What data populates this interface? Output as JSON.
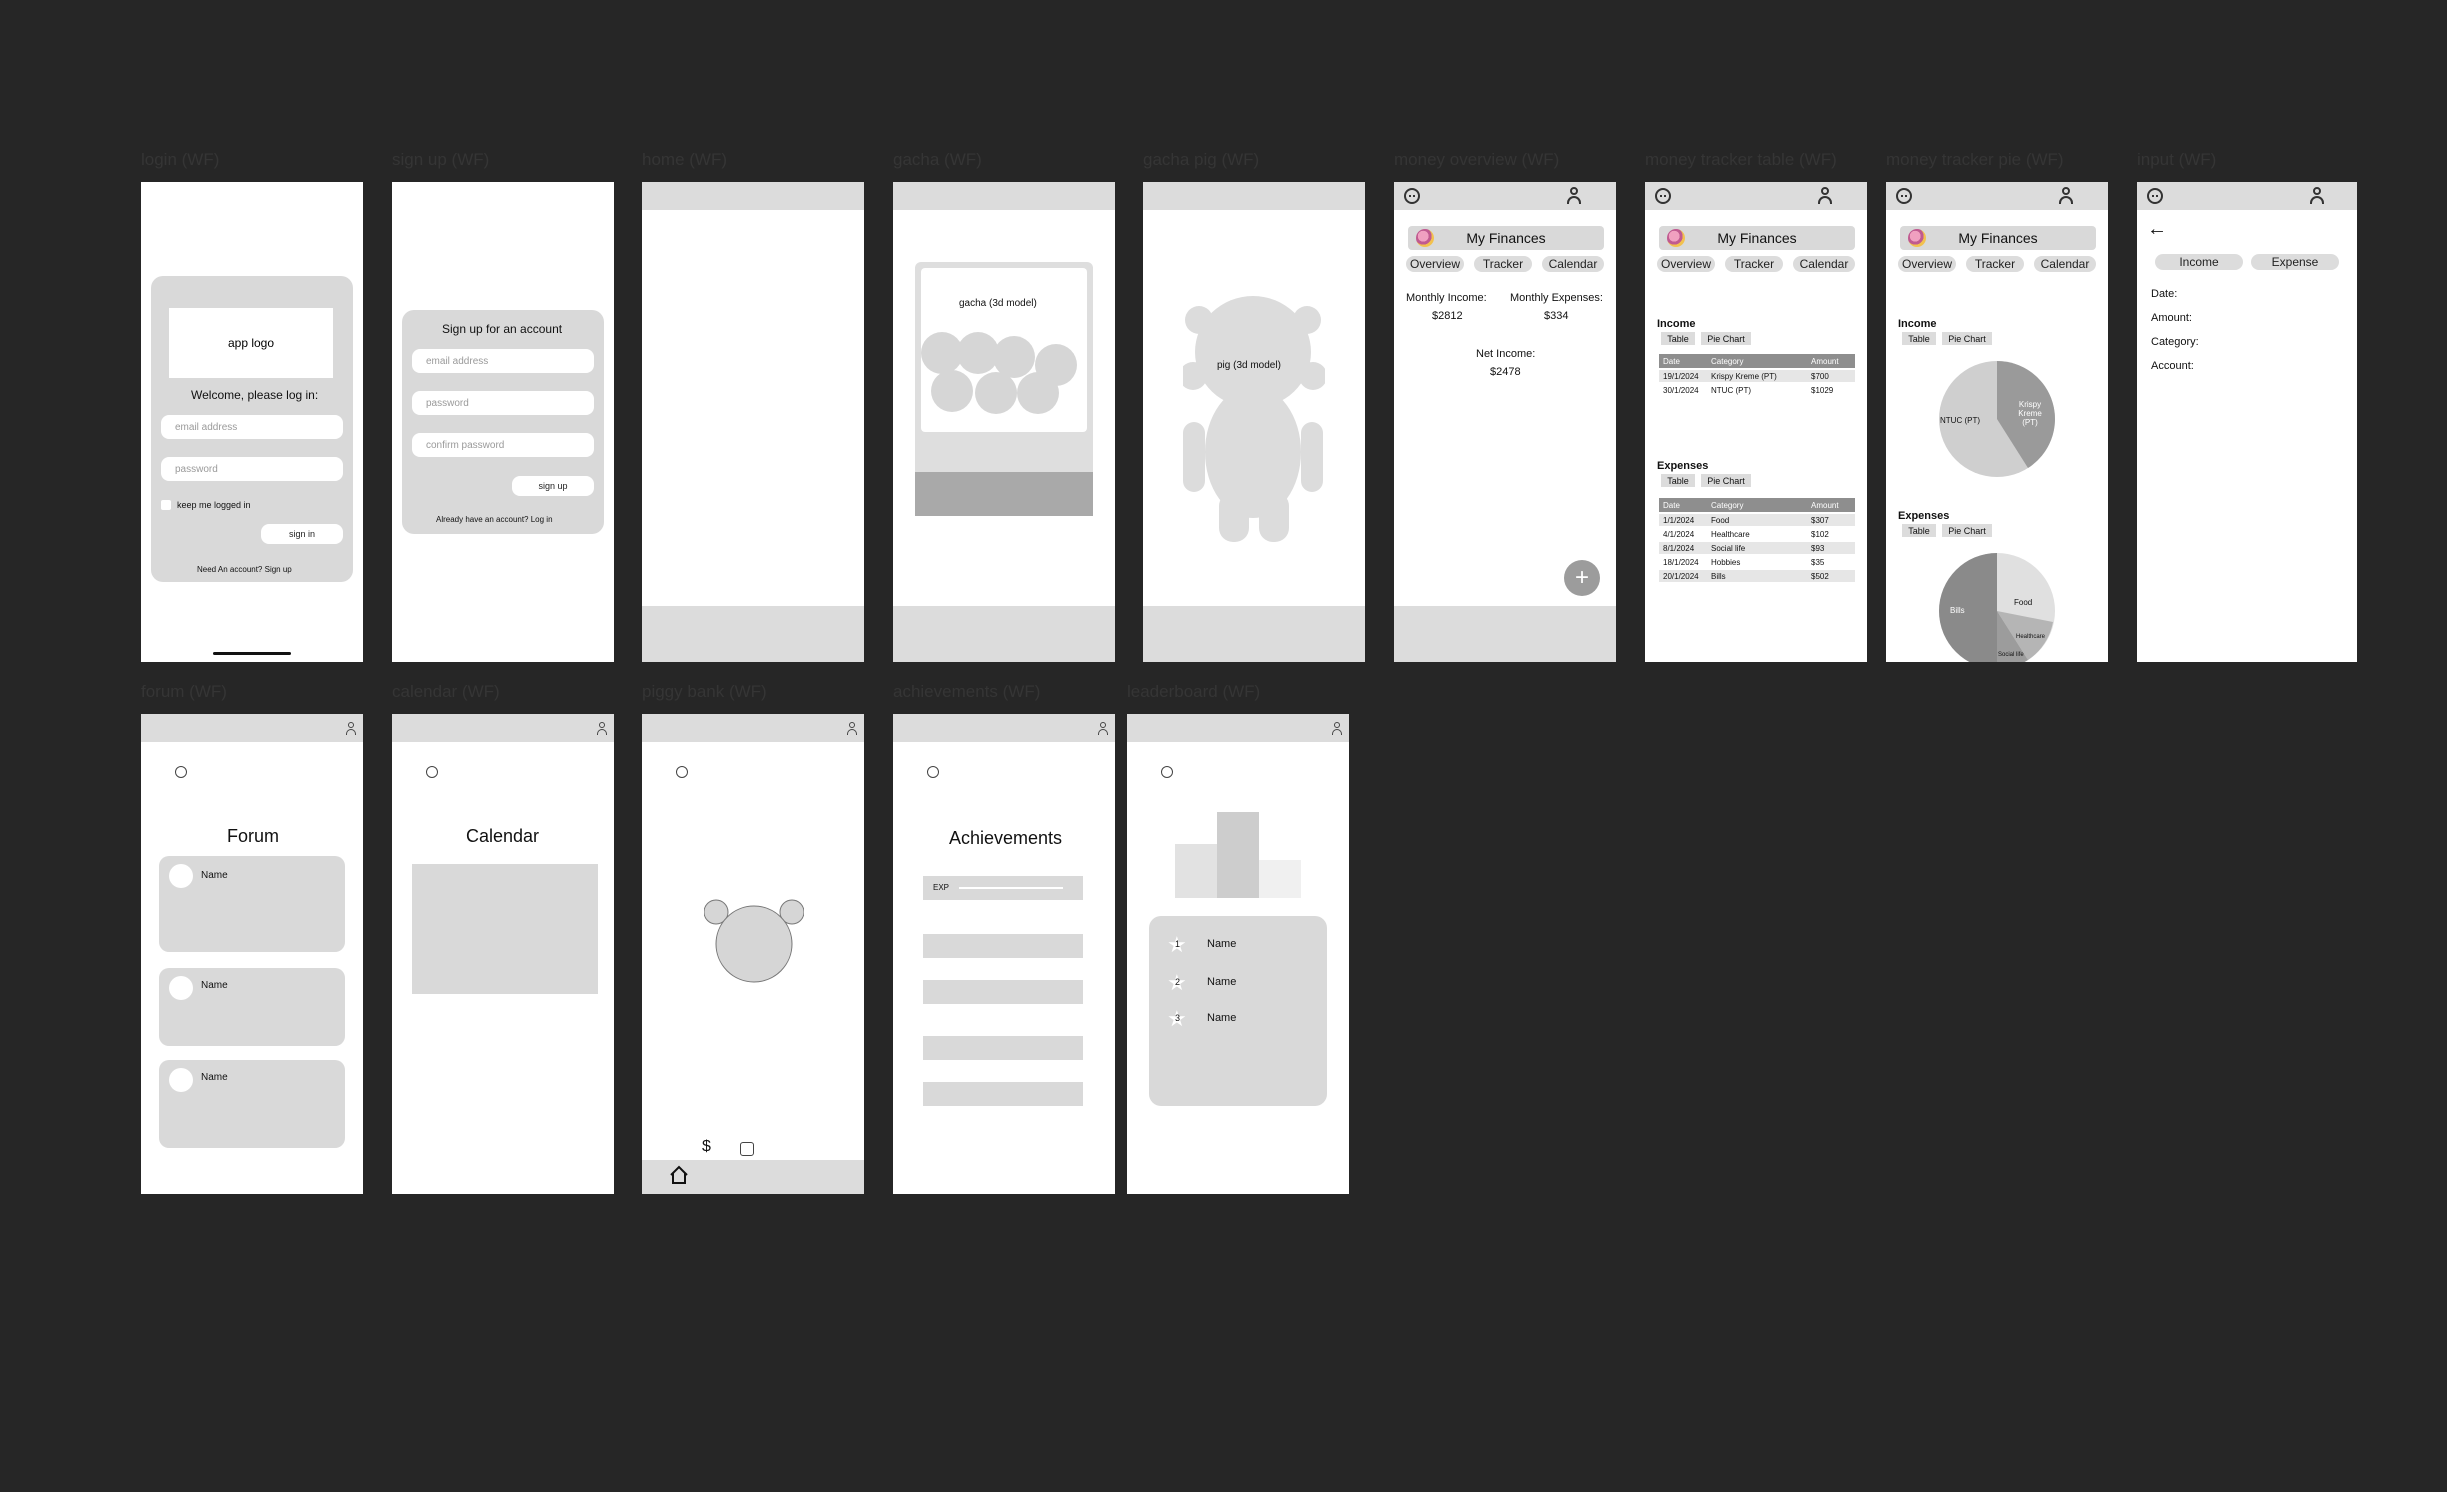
{
  "canvas": {
    "background": "#262626"
  },
  "frames": {
    "login": {
      "label": "login (WF)",
      "logo": "app logo",
      "welcome": "Welcome, please log in:",
      "email_placeholder": "email address",
      "password_placeholder": "password",
      "keep_logged": "keep me logged in",
      "signin": "sign in",
      "need_account": "Need An account? Sign up"
    },
    "signup": {
      "label": "sign up (WF)",
      "title": "Sign up for an account",
      "email_placeholder": "email address",
      "password_placeholder": "password",
      "confirm_placeholder": "confirm password",
      "signup": "sign up",
      "already": "Already have an account? Log in"
    },
    "home": {
      "label": "home (WF)"
    },
    "gacha": {
      "label": "gacha (WF)",
      "model": "gacha (3d model)"
    },
    "gacha_pig": {
      "label": "gacha pig (WF)",
      "model": "pig (3d model)"
    },
    "money_overview": {
      "label": "money overview (WF)",
      "title": "My Finances",
      "tabs": [
        "Overview",
        "Tracker",
        "Calendar"
      ],
      "monthly_income_label": "Monthly Income:",
      "monthly_income": "$2812",
      "monthly_expenses_label": "Monthly Expenses:",
      "monthly_expenses": "$334",
      "net_income_label": "Net Income:",
      "net_income": "$2478"
    },
    "money_tracker_table": {
      "label": "money tracker table (WF)",
      "title": "My Finances",
      "tabs": [
        "Overview",
        "Tracker",
        "Calendar"
      ],
      "income_title": "Income",
      "expenses_title": "Expenses",
      "view_tabs": [
        "Table",
        "Pie Chart"
      ],
      "columns": [
        "Date",
        "Category",
        "Amount"
      ],
      "income_rows": [
        [
          "19/1/2024",
          "Krispy Kreme (PT)",
          "$700"
        ],
        [
          "30/1/2024",
          "NTUC (PT)",
          "$1029"
        ]
      ],
      "expense_rows": [
        [
          "1/1/2024",
          "Food",
          "$307"
        ],
        [
          "4/1/2024",
          "Healthcare",
          "$102"
        ],
        [
          "8/1/2024",
          "Social life",
          "$93"
        ],
        [
          "18/1/2024",
          "Hobbies",
          "$35"
        ],
        [
          "20/1/2024",
          "Bills",
          "$502"
        ]
      ]
    },
    "money_tracker_pie": {
      "label": "money tracker pie (WF)",
      "title": "My Finances",
      "tabs": [
        "Overview",
        "Tracker",
        "Calendar"
      ],
      "income_title": "Income",
      "expenses_title": "Expenses",
      "view_tabs": [
        "Table",
        "Pie Chart"
      ],
      "income_slices": [
        "Krispy Kreme (PT)",
        "NTUC (PT)"
      ],
      "expense_slices": [
        "Food",
        "Bills",
        "Healthcare",
        "Social life"
      ]
    },
    "input": {
      "label": "input (WF)",
      "income": "Income",
      "expense": "Expense",
      "fields": [
        "Date:",
        "Amount:",
        "Category:",
        "Account:"
      ]
    },
    "forum": {
      "label": "forum (WF)",
      "title": "Forum",
      "posts": [
        "Name",
        "Name",
        "Name"
      ]
    },
    "calendar": {
      "label": "calendar (WF)",
      "title": "Calendar"
    },
    "piggy_bank": {
      "label": "piggy bank (WF)",
      "dollar": "$"
    },
    "achievements": {
      "label": "achievements (WF)",
      "title": "Achievements",
      "exp": "EXP"
    },
    "leaderboard": {
      "label": "leaderboard (WF)",
      "entries": [
        {
          "rank": "1",
          "name": "Name"
        },
        {
          "rank": "2",
          "name": "Name"
        },
        {
          "rank": "3",
          "name": "Name"
        }
      ]
    }
  }
}
